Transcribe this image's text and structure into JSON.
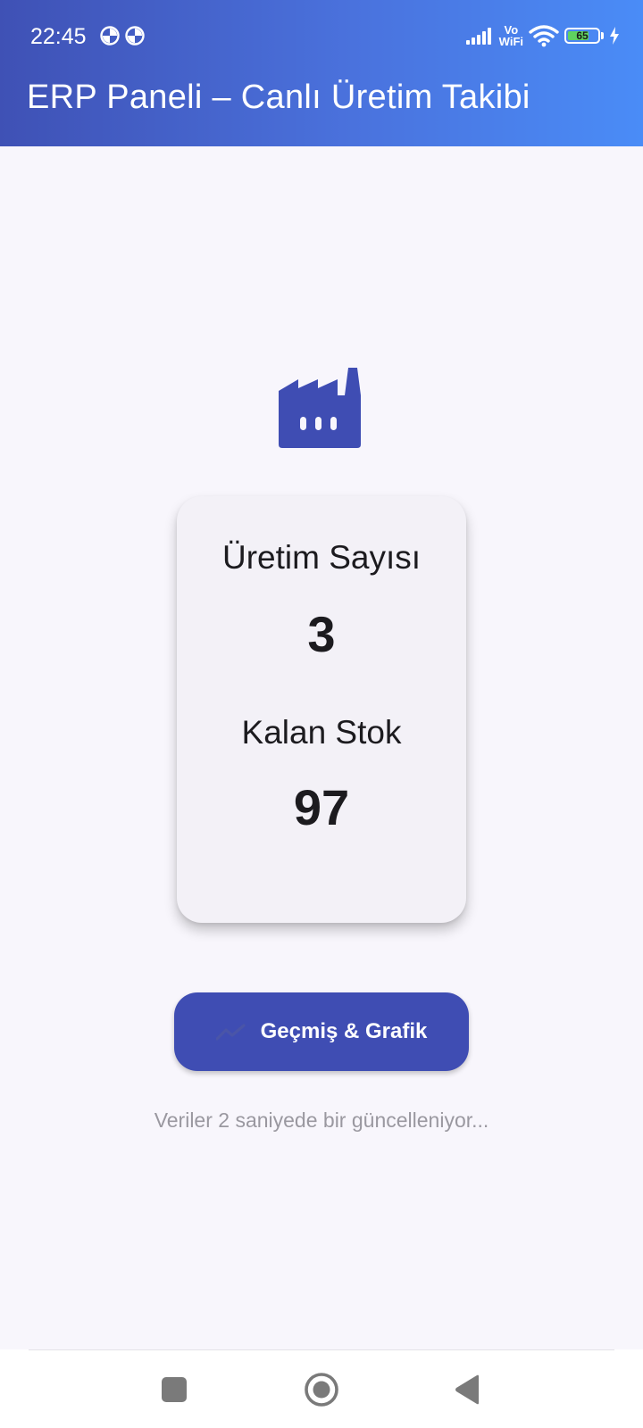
{
  "status_bar": {
    "time": "22:45",
    "network_label_top": "Vo",
    "network_label_bottom": "WiFi",
    "battery_level": "65",
    "icons": [
      "notification-icon",
      "notification-icon",
      "signal-icon",
      "volte-icon",
      "wifi-icon",
      "battery-icon",
      "charging-icon"
    ]
  },
  "app_bar": {
    "title": "ERP Paneli – Canlı Üretim Takibi"
  },
  "main": {
    "hero_icon": "factory-icon",
    "card": {
      "production_label": "Üretim Sayısı",
      "production_value": "3",
      "stock_label": "Kalan Stok",
      "stock_value": "97"
    },
    "history_button": {
      "label": "Geçmiş & Grafik",
      "icon": "trending-up-icon"
    },
    "update_note": "Veriler 2 saniyede bir güncelleniyor..."
  },
  "nav_bar": {
    "icons": [
      "recents-icon",
      "home-icon",
      "back-icon"
    ]
  },
  "colors": {
    "header_start": "#3f51b5",
    "header_end": "#4a8cf7",
    "accent": "#3f4db3",
    "background": "#f8f6fc",
    "card": "#f3f1f7"
  }
}
